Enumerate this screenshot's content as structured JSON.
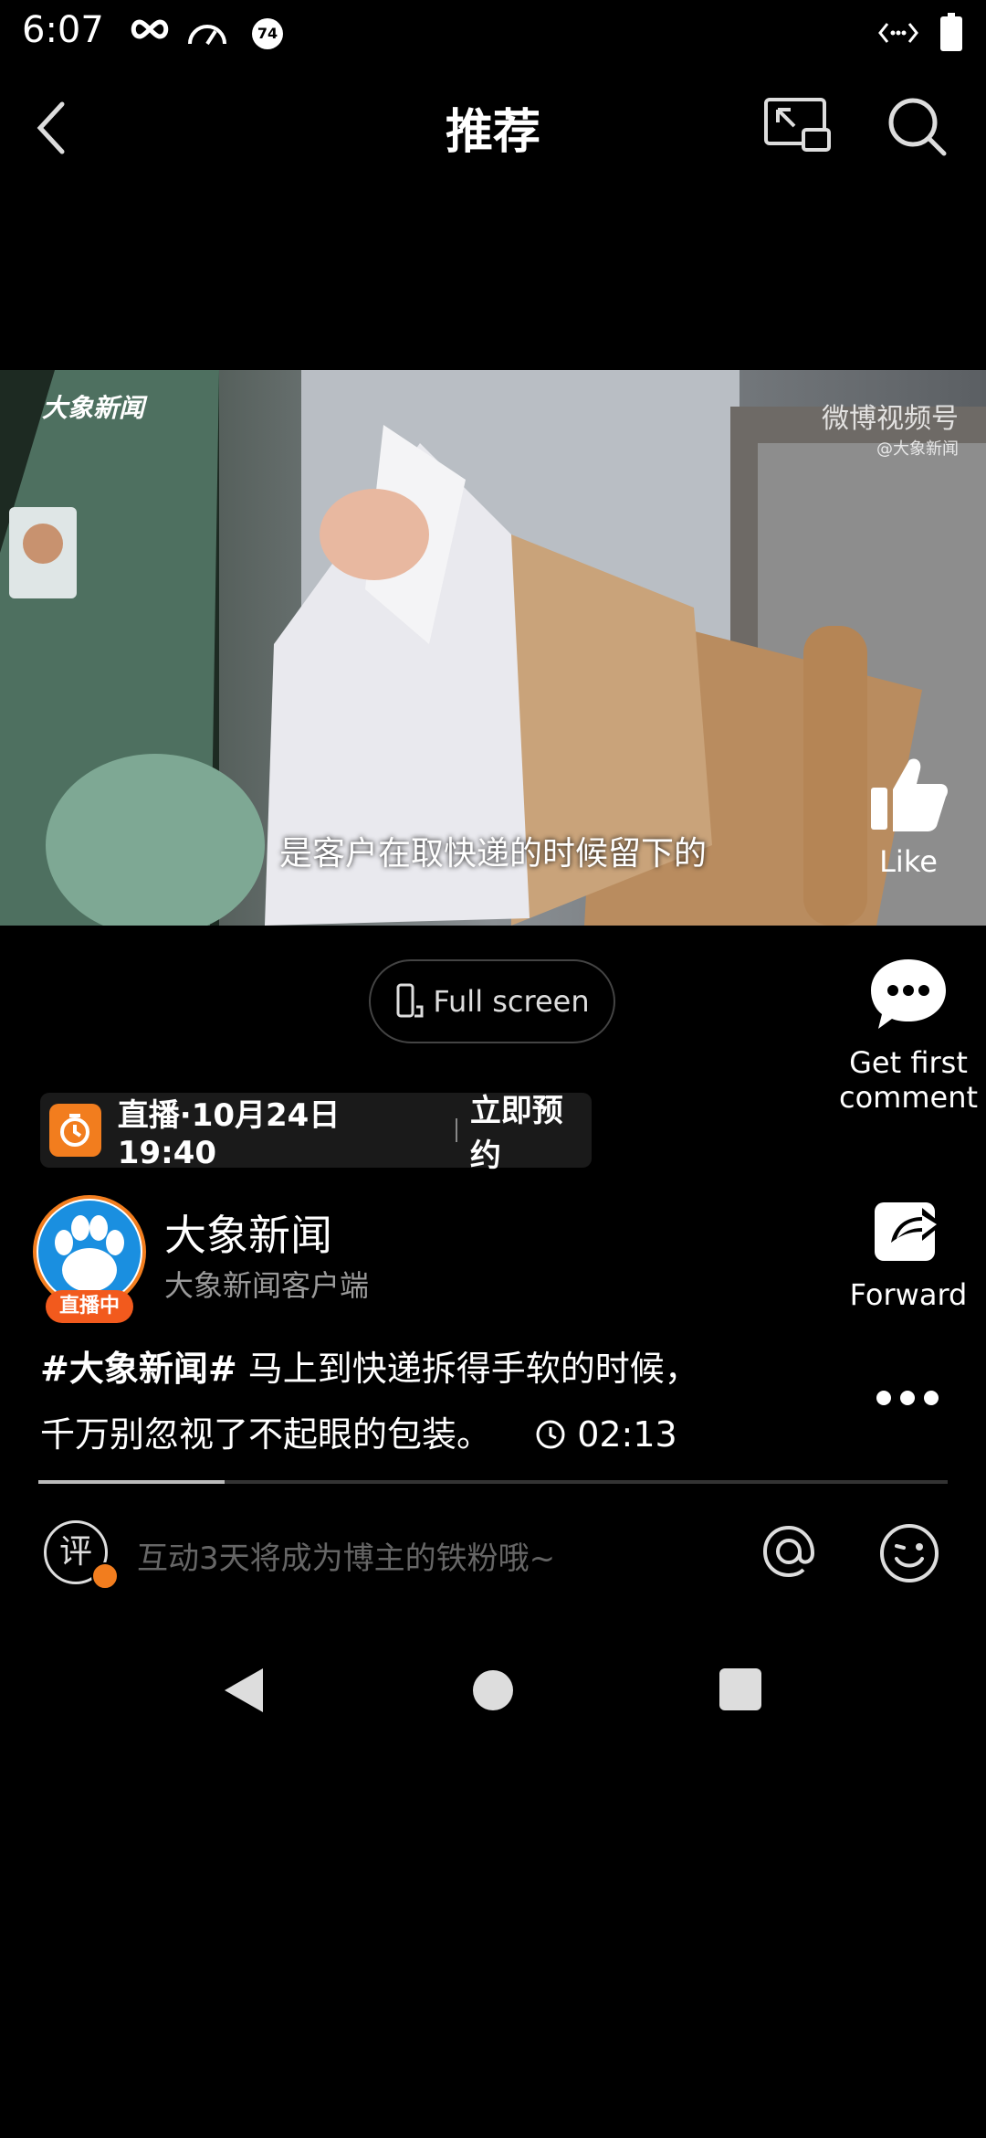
{
  "status_bar": {
    "time": "6:07",
    "battery_badge": "74"
  },
  "header": {
    "title": "推荐"
  },
  "video": {
    "subtitle": "是客户在取快递的时候留下的",
    "brand_logo": "大象新闻",
    "watermark": "微博视频号",
    "watermark_sub": "@大象新闻"
  },
  "actions": {
    "like": "Like",
    "comment": "Get first comment",
    "forward": "Forward"
  },
  "fullscreen_label": "Full screen",
  "live_banner": {
    "text": "直播·10月24日 19:40",
    "cta": "立即预约"
  },
  "author": {
    "name": "大象新闻",
    "subtitle": "大象新闻客户端",
    "live_badge": "直播中"
  },
  "post": {
    "hashtag": "#大象新闻#",
    "text_line1": "马上到快递拆得手软的时候，",
    "text_line2": "千万别忽视了不起眼的包装。",
    "duration": "02:13"
  },
  "progress_fraction": 0.205,
  "comment_bar": {
    "icon_text": "评",
    "placeholder": "互动3天将成为博主的铁粉哦~"
  },
  "colors": {
    "accent": "#f27d1e",
    "background": "#000000"
  }
}
